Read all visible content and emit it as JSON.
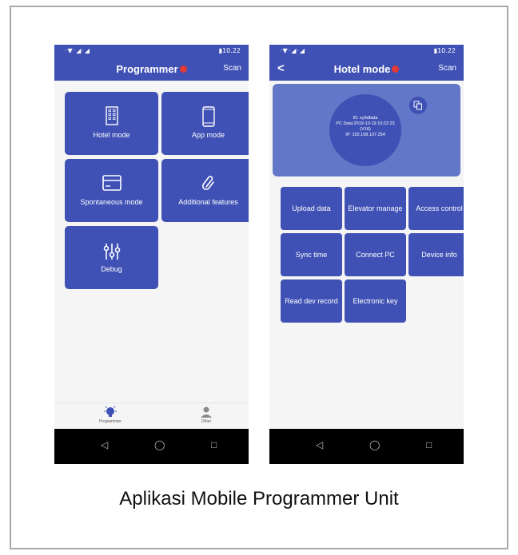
{
  "caption": "Aplikasi Mobile Programmer Unit",
  "colors": {
    "primary": "#3f51b5",
    "card": "#6277c7",
    "badge": "#e53935"
  },
  "phone1": {
    "status_left": "·▼·◢·◢",
    "status_time": "▮10.22",
    "title": "Programmer",
    "scan": "Scan",
    "tiles": [
      {
        "label": "Hotel mode",
        "icon": "hotel-icon"
      },
      {
        "label": "App mode",
        "icon": "phone-icon"
      },
      {
        "label": "Spontaneous mode",
        "icon": "card-icon"
      },
      {
        "label": "Additional features",
        "icon": "paperclip-icon"
      },
      {
        "label": "Debug",
        "icon": "sliders-icon"
      }
    ],
    "nav": [
      {
        "label": "Programmer",
        "icon": "bulb-icon"
      },
      {
        "label": "Other",
        "icon": "person-icon"
      }
    ],
    "sys": {
      "back": "◁",
      "home": "◯",
      "recent": "□"
    }
  },
  "phone2": {
    "status_left": "·▼·◢·◢",
    "status_time": "▮10.22",
    "back": "<",
    "title": "Hotel mode",
    "scan": "Scan",
    "device": {
      "id": "ID: sy6dfada",
      "pc_data": "PC Data:2019-10-19 10:22:23",
      "version": "(V16)",
      "ip": "IP: 192.168.137.254"
    },
    "buttons": [
      "Upload data",
      "Elevator manage",
      "Access control",
      "Sync time",
      "Connect PC",
      "Device info",
      "Read dev record",
      "Electronic key"
    ],
    "sys": {
      "back": "◁",
      "home": "◯",
      "recent": "□"
    }
  }
}
